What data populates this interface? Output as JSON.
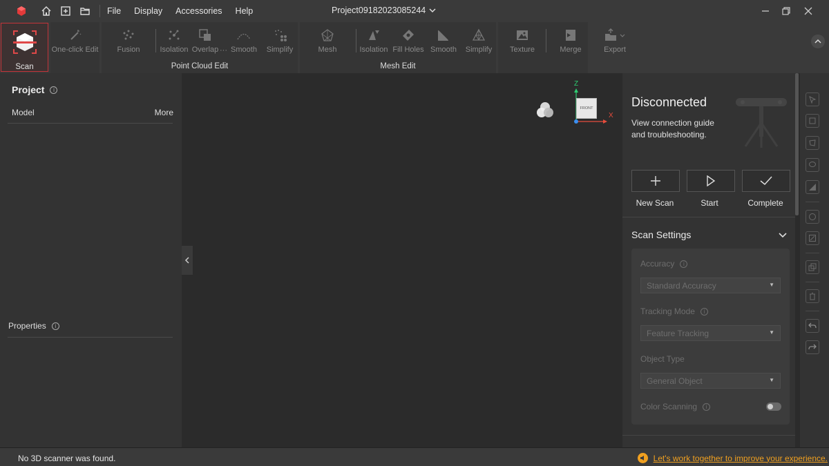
{
  "menu": [
    "File",
    "Display",
    "Accessories",
    "Help"
  ],
  "project": {
    "name": "Project09182023085244"
  },
  "ribbon": {
    "scan_label": "Scan",
    "one_click_label": "One-click Edit",
    "point_cloud": {
      "group_label": "Point Cloud Edit",
      "tools": [
        "Fusion",
        "Isolation",
        "Overlap",
        "Smooth",
        "Simplify"
      ]
    },
    "mesh": {
      "group_label": "Mesh Edit",
      "tools": [
        "Mesh",
        "Isolation",
        "Fill Holes",
        "Smooth",
        "Simplify"
      ]
    },
    "texture_label": "Texture",
    "merge_label": "Merge",
    "export_label": "Export"
  },
  "left_panel": {
    "project_title": "Project",
    "model_label": "Model",
    "more_label": "More",
    "properties_label": "Properties"
  },
  "viewport": {
    "axis_z": "Z",
    "axis_x": "X",
    "cube_face": "FRONT"
  },
  "scanner": {
    "status": "Disconnected",
    "description": "View connection guide and troubleshooting.",
    "actions": {
      "new_scan": "New Scan",
      "start": "Start",
      "complete": "Complete"
    }
  },
  "scan_settings": {
    "title": "Scan Settings",
    "accuracy_label": "Accuracy",
    "accuracy_value": "Standard Accuracy",
    "tracking_label": "Tracking Mode",
    "tracking_value": "Feature Tracking",
    "object_label": "Object Type",
    "object_value": "General Object",
    "color_label": "Color Scanning"
  },
  "status_bar": {
    "message": "No 3D scanner was found.",
    "feedback": "Let's work together to improve your experience."
  },
  "colors": {
    "accent": "#c4343a",
    "feedback": "#f0a020",
    "background": "#2b2b2b"
  }
}
